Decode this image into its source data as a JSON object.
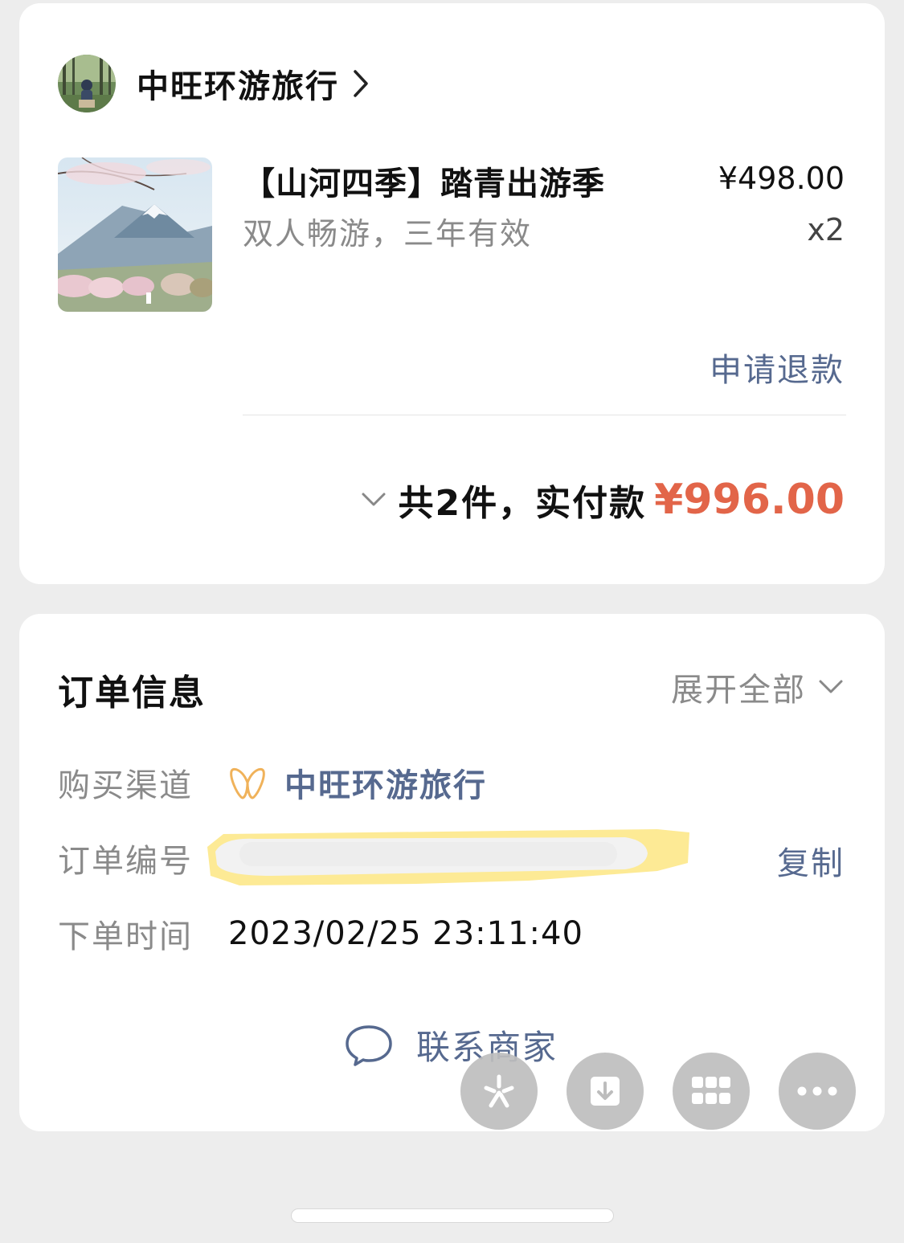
{
  "shop": {
    "name": "中旺环游旅行"
  },
  "product": {
    "title": "【山河四季】踏青出游季",
    "subtitle": "双人畅游，三年有效",
    "price": "¥498.00",
    "quantity": "x2",
    "refund_label": "申请退款"
  },
  "summary": {
    "text": "共2件，实付款",
    "amount": "¥996.00"
  },
  "order_info": {
    "title": "订单信息",
    "expand_label": "展开全部",
    "channel_label": "购买渠道",
    "channel_value": "中旺环游旅行",
    "order_no_label": "订单编号",
    "copy_label": "复制",
    "time_label": "下单时间",
    "time_value": "2023/02/25 23:11:40",
    "contact_label": "联系商家"
  },
  "colors": {
    "accent_link": "#56698f",
    "price_red": "#e26549",
    "redaction_highlight": "#fde88a"
  },
  "icons": {
    "shop_chevron": "chevron-right-icon",
    "total_chevron": "chevron-down-icon",
    "expand_chevron": "chevron-down-icon",
    "channel": "butterfly-logo-icon",
    "contact": "chat-bubble-icon",
    "fab": [
      "sparkle-icon",
      "download-icon",
      "grid-icon",
      "more-icon"
    ]
  }
}
